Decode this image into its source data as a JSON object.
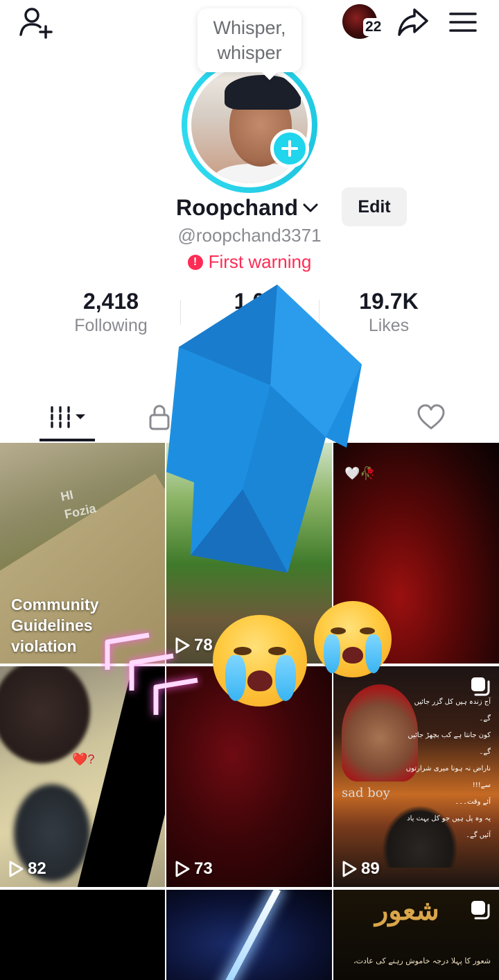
{
  "header": {
    "add_friend_icon": "person-add-icon",
    "story_count": "22",
    "share_icon": "share-arrow-icon",
    "menu_icon": "hamburger-menu-icon"
  },
  "tooltip": {
    "text": "Whisper, whisper"
  },
  "profile": {
    "name": "Roopchand",
    "handle": "@roopchand3371",
    "warning": "First warning",
    "edit_label": "Edit"
  },
  "stats": [
    {
      "value": "2,418",
      "label": "Following"
    },
    {
      "value": "1,0",
      "label": ""
    },
    {
      "value": "19.7K",
      "label": "Likes"
    }
  ],
  "tabs": [
    "videos-grid",
    "private",
    "liked"
  ],
  "videos": [
    {
      "views": "",
      "overlay_text": "Community Guidelines violation",
      "watermark": "HI\nFozia"
    },
    {
      "views": "78"
    },
    {
      "views": "",
      "overlay_text": "🤍🥀"
    },
    {
      "views": "82",
      "overlay_text": "❤️?"
    },
    {
      "views": "73"
    },
    {
      "views": "89",
      "overlay_text": "sad boy",
      "urdu_lines": [
        "آج زندہ ہیں کل گزر جائیں گے۔",
        "کون جانتا ہے کب بچھڑ جائیں گے۔",
        "ناراض نہ ہونا میری شرارتوں سے!!!",
        "آئے وقت۔۔۔",
        "یہ وہ پل ہیں جو کل بہت یاد آئیں گے۔"
      ]
    },
    {
      "views": ""
    },
    {
      "views": ""
    },
    {
      "views": "",
      "overlay_title": "شعور",
      "urdu_line": "شعور کا پہلا درجہ خاموش رہنے کی عادت،"
    }
  ],
  "colors": {
    "accent": "#20d5ec",
    "warning": "#fe2c55",
    "arrow": "#1e8fe0"
  }
}
